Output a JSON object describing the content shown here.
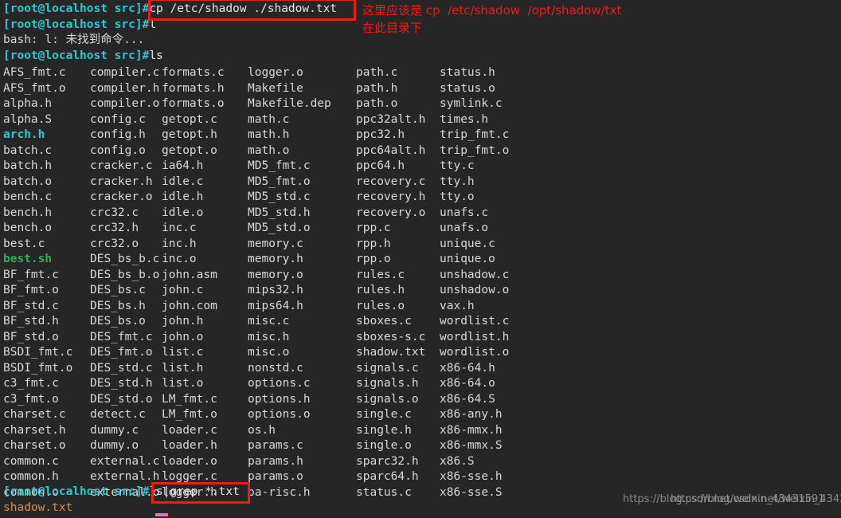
{
  "terminal": {
    "background": "#262626",
    "foreground": "#d8d8d8",
    "prompt_color": "#2ec9d6",
    "annotation_color": "#ee1c17",
    "cursor_color": "#ef6fb4",
    "prompt": "[root@localhost src]#",
    "lines": [
      {
        "id": "l1",
        "prompt": "[root@localhost src]#",
        "command": "cp /etc/shadow ./shadow.txt"
      },
      {
        "id": "l2",
        "prompt": "[root@localhost src]#",
        "command": "l"
      },
      {
        "id": "l3",
        "output": "bash: l: 未找到命令..."
      },
      {
        "id": "l4",
        "prompt": "[root@localhost src]#",
        "command": "ls"
      },
      {
        "id": "l5",
        "prompt": "[root@localhost src]#",
        "command": "ls|grep *.txt"
      },
      {
        "id": "l6",
        "output": "shadow.txt"
      }
    ]
  },
  "ls_output": {
    "columns": 6,
    "rows": [
      [
        "AFS_fmt.c",
        "compiler.c",
        "formats.c",
        "logger.o",
        "path.c",
        "status.h"
      ],
      [
        "AFS_fmt.o",
        "compiler.h",
        "formats.h",
        "Makefile",
        "path.h",
        "status.o"
      ],
      [
        "alpha.h",
        "compiler.o",
        "formats.o",
        "Makefile.dep",
        "path.o",
        "symlink.c"
      ],
      [
        "alpha.S",
        "config.c",
        "getopt.c",
        "math.c",
        "ppc32alt.h",
        "times.h"
      ],
      [
        "arch.h",
        "config.h",
        "getopt.h",
        "math.h",
        "ppc32.h",
        "trip_fmt.c"
      ],
      [
        "batch.c",
        "config.o",
        "getopt.o",
        "math.o",
        "ppc64alt.h",
        "trip_fmt.o"
      ],
      [
        "batch.h",
        "cracker.c",
        "ia64.h",
        "MD5_fmt.c",
        "ppc64.h",
        "tty.c"
      ],
      [
        "batch.o",
        "cracker.h",
        "idle.c",
        "MD5_fmt.o",
        "recovery.c",
        "tty.h"
      ],
      [
        "bench.c",
        "cracker.o",
        "idle.h",
        "MD5_std.c",
        "recovery.h",
        "tty.o"
      ],
      [
        "bench.h",
        "crc32.c",
        "idle.o",
        "MD5_std.h",
        "recovery.o",
        "unafs.c"
      ],
      [
        "bench.o",
        "crc32.h",
        "inc.c",
        "MD5_std.o",
        "rpp.c",
        "unafs.o"
      ],
      [
        "best.c",
        "crc32.o",
        "inc.h",
        "memory.c",
        "rpp.h",
        "unique.c"
      ],
      [
        "best.sh",
        "DES_bs_b.c",
        "inc.o",
        "memory.h",
        "rpp.o",
        "unique.o"
      ],
      [
        "BF_fmt.c",
        "DES_bs_b.o",
        "john.asm",
        "memory.o",
        "rules.c",
        "unshadow.c"
      ],
      [
        "BF_fmt.o",
        "DES_bs.c",
        "john.c",
        "mips32.h",
        "rules.h",
        "unshadow.o"
      ],
      [
        "BF_std.c",
        "DES_bs.h",
        "john.com",
        "mips64.h",
        "rules.o",
        "vax.h"
      ],
      [
        "BF_std.h",
        "DES_bs.o",
        "john.h",
        "misc.c",
        "sboxes.c",
        "wordlist.c"
      ],
      [
        "BF_std.o",
        "DES_fmt.c",
        "john.o",
        "misc.h",
        "sboxes-s.c",
        "wordlist.h"
      ],
      [
        "BSDI_fmt.c",
        "DES_fmt.o",
        "list.c",
        "misc.o",
        "shadow.txt",
        "wordlist.o"
      ],
      [
        "BSDI_fmt.o",
        "DES_std.c",
        "list.h",
        "nonstd.c",
        "signals.c",
        "x86-64.h"
      ],
      [
        "c3_fmt.c",
        "DES_std.h",
        "list.o",
        "options.c",
        "signals.h",
        "x86-64.o"
      ],
      [
        "c3_fmt.o",
        "DES_std.o",
        "LM_fmt.c",
        "options.h",
        "signals.o",
        "x86-64.S"
      ],
      [
        "charset.c",
        "detect.c",
        "LM_fmt.o",
        "options.o",
        "single.c",
        "x86-any.h"
      ],
      [
        "charset.h",
        "dummy.c",
        "loader.c",
        "os.h",
        "single.h",
        "x86-mmx.h"
      ],
      [
        "charset.o",
        "dummy.o",
        "loader.h",
        "params.c",
        "single.o",
        "x86-mmx.S"
      ],
      [
        "common.c",
        "external.c",
        "loader.o",
        "params.h",
        "sparc32.h",
        "x86.S"
      ],
      [
        "common.h",
        "external.h",
        "logger.c",
        "params.o",
        "sparc64.h",
        "x86-sse.h"
      ],
      [
        "common.o",
        "external.o",
        "logger.h",
        "pa-risc.h",
        "status.c",
        "x86-sse.S"
      ]
    ],
    "highlight": {
      "arch.h": "cyan",
      "best.sh": "green"
    }
  },
  "annotations": {
    "line1": "这里应该是 cp  /etc/shadow  /opt/shadow/txt",
    "line2": "在此目录下",
    "box_cp_label": "cp /etc/shadow ./shadow.txt",
    "box_grep_label": "ls|grep *.txt"
  },
  "watermark": {
    "text1": "https://blog.csdn.net/weixin_43431591",
    "text2": "https://blog.csdn.net/weixin_43431591"
  }
}
